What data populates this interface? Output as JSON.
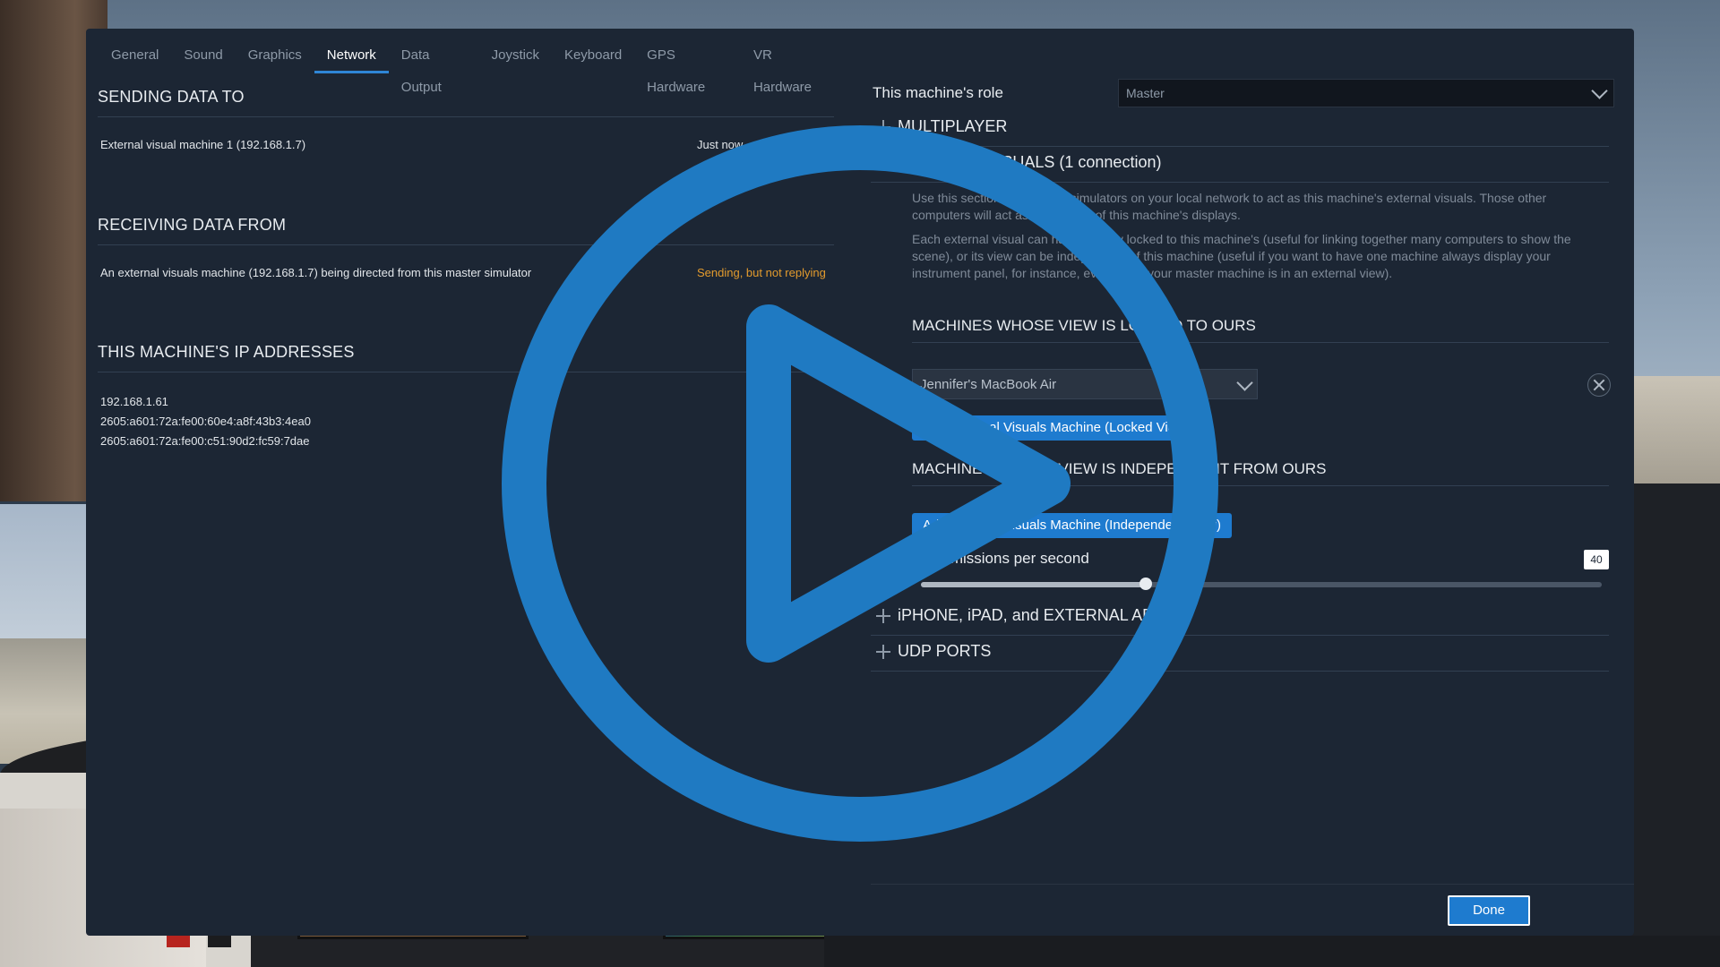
{
  "tabs": [
    {
      "label": "General"
    },
    {
      "label": "Sound"
    },
    {
      "label": "Graphics"
    },
    {
      "label": "Network",
      "active": true
    },
    {
      "label": "Data Output"
    },
    {
      "label": "Joystick"
    },
    {
      "label": "Keyboard"
    },
    {
      "label": "GPS Hardware"
    },
    {
      "label": "VR Hardware"
    }
  ],
  "sending": {
    "heading": "SENDING DATA TO",
    "row_label": "External visual machine 1 (192.168.1.7)",
    "row_status": "Just now"
  },
  "receiving": {
    "heading": "RECEIVING DATA FROM",
    "row_label": "An external visuals machine (192.168.1.7) being directed from this master simulator",
    "row_status": "Sending, but not replying"
  },
  "ip": {
    "heading": "THIS MACHINE'S IP ADDRESSES",
    "addresses": [
      "192.168.1.61",
      "2605:a601:72a:fe00:60e4:a8f:43b3:4ea0",
      "2605:a601:72a:fe00:c51:90d2:fc59:7dae"
    ]
  },
  "role": {
    "label": "This machine's role",
    "value": "Master"
  },
  "multiplayer": {
    "label": "MULTIPLAYER"
  },
  "external_visuals": {
    "label": "EXTERNAL VISUALS (1 connection)",
    "para1": "Use this section to set other simulators on your local network to act as this machine's external visuals. Those other computers will act as extensions of this machine's displays.",
    "para2": "Each external visual can have its view locked to this machine's (useful for linking together many computers to show the scene), or its view can be independent of this machine (useful if you want to have one machine always display your instrument panel, for instance, even when your master machine is in an external view).",
    "locked_heading": "MACHINES WHOSE VIEW IS LOCKED TO OURS",
    "locked_machine": "Jennifer's MacBook Air",
    "add_locked_label": "Add External Visuals Machine (Locked View)",
    "independent_heading": "MACHINES WHOSE VIEW IS INDEPENDENT FROM OURS",
    "add_independent_label": "Add External Visuals Machine (Independent View)",
    "rate_label": "Transmissions per second",
    "rate_value": "40",
    "rate_fraction": 0.33
  },
  "iphone": {
    "label": "iPHONE, iPAD, and EXTERNAL APPS"
  },
  "udp": {
    "label": "UDP PORTS"
  },
  "done_label": "Done",
  "colors": {
    "accent": "#2f86d6",
    "button": "#1e7bcf",
    "warning": "#e39b2d",
    "play": "#1f7ac2"
  },
  "icons": {
    "play": "play-icon",
    "dropdown": "chevron-down-icon",
    "remove": "close-icon",
    "expand": "plus-icon"
  }
}
